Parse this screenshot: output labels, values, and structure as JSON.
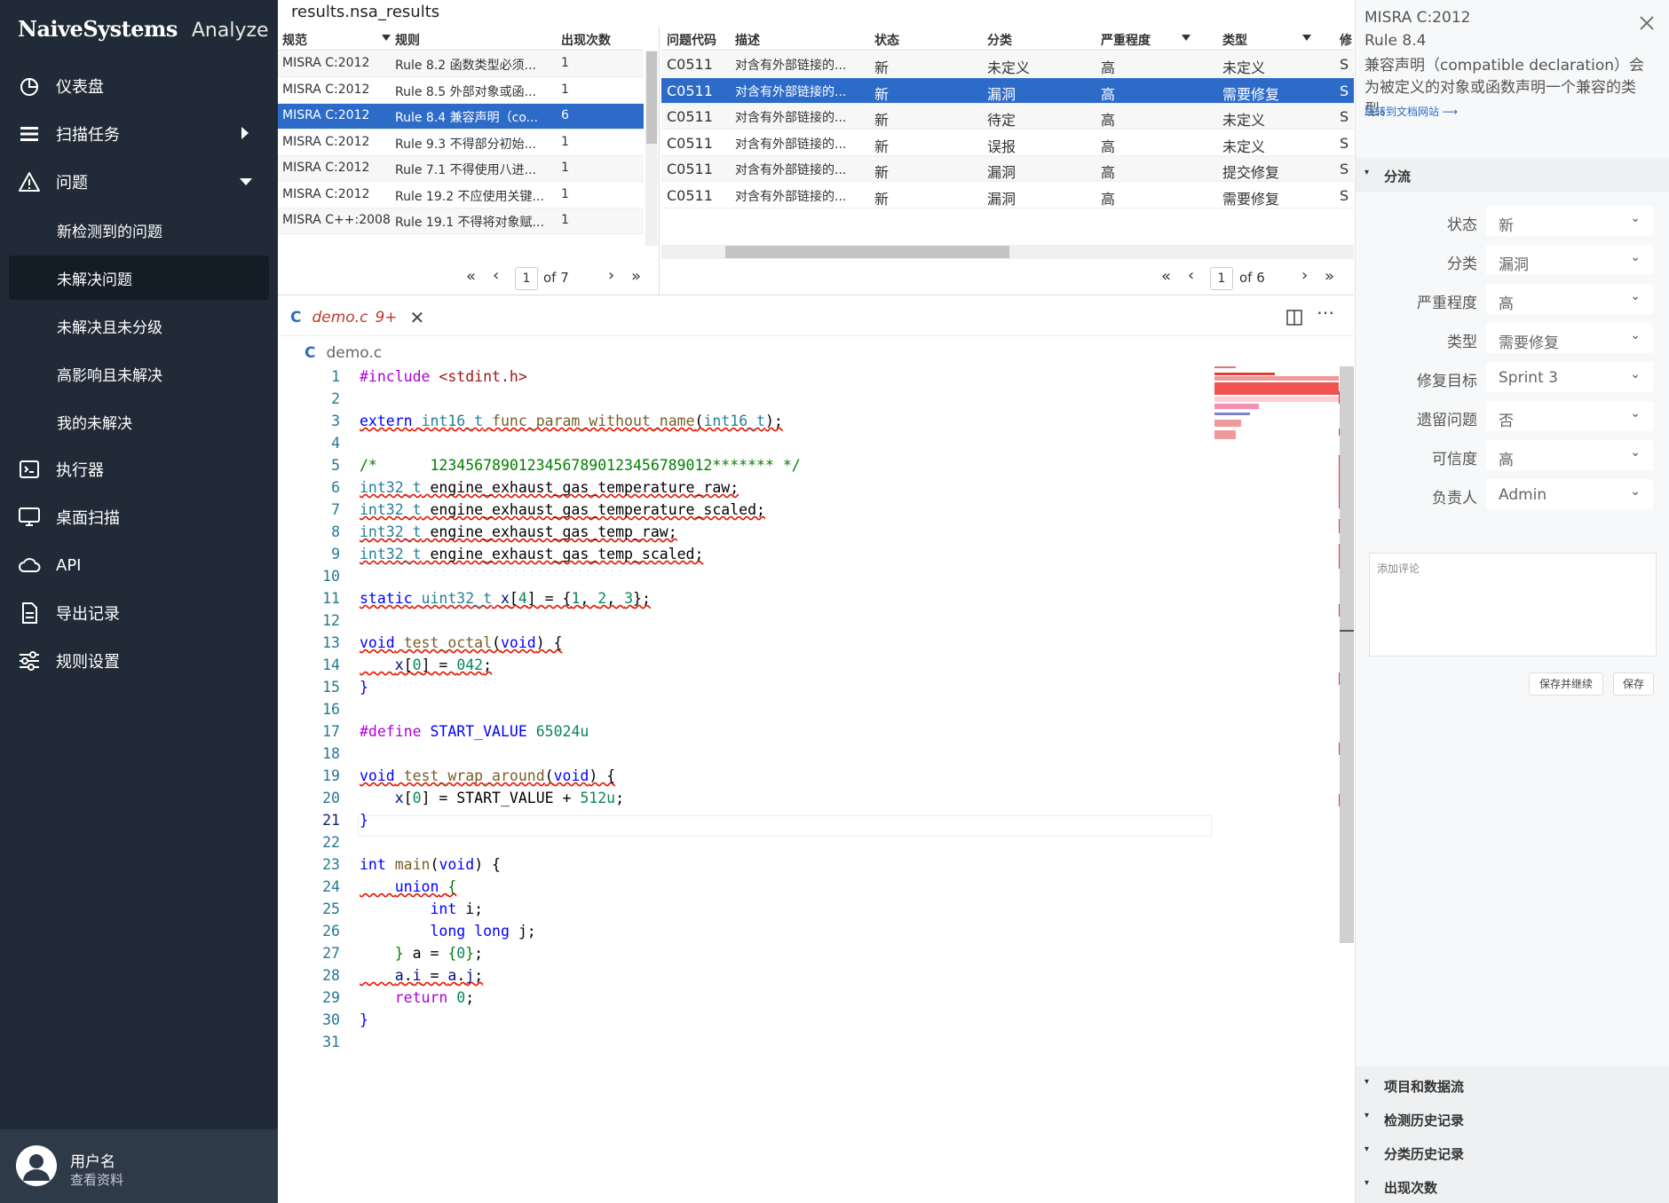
{
  "brand": {
    "name": "NaiveSystems",
    "product": "Analyze"
  },
  "nav": [
    {
      "label": "仪表盘",
      "icon": "dashboard-icon"
    },
    {
      "label": "扫描任务",
      "icon": "list-icon"
    },
    {
      "label": "问题",
      "icon": "warning-icon"
    }
  ],
  "issues_sub": [
    "新检测到的问题",
    "未解决问题",
    "未解决且未分级",
    "高影响且未解决",
    "我的未解决"
  ],
  "nav2": [
    {
      "label": "执行器",
      "icon": "terminal-icon"
    },
    {
      "label": "桌面扫描",
      "icon": "monitor-icon"
    },
    {
      "label": "API",
      "icon": "cloud-icon"
    },
    {
      "label": "导出记录",
      "icon": "document-icon"
    },
    {
      "label": "规则设置",
      "icon": "sliders-icon"
    }
  ],
  "user": {
    "name": "用户名",
    "link": "查看资料"
  },
  "results_title": "results.nsa_results",
  "rules_table": {
    "headers": [
      "规范",
      "规则",
      "出现次数"
    ],
    "rows": [
      [
        "MISRA C:2012",
        "Rule 8.2 函数类型必须...",
        "1"
      ],
      [
        "MISRA C:2012",
        "Rule 8.5 外部对象或函...",
        "1"
      ],
      [
        "MISRA C:2012",
        "Rule 8.4 兼容声明（co...",
        "6"
      ],
      [
        "MISRA C:2012",
        "Rule 9.3 不得部分初始...",
        "1"
      ],
      [
        "MISRA C:2012",
        "Rule 7.1  不得使用八进...",
        "1"
      ],
      [
        "MISRA C:2012",
        "Rule 19.2 不应使用关键...",
        "1"
      ],
      [
        "MISRA C++:2008",
        "Rule 19.1 不得将对象赋...",
        "1"
      ]
    ],
    "page": "1",
    "of": "of 7"
  },
  "issues_table": {
    "headers": [
      "问题代码",
      "描述",
      "状态",
      "分类",
      "严重程度",
      "类型",
      "修"
    ],
    "rows": [
      [
        "C0511",
        "对含有外部链接的...",
        "新",
        "未定义",
        "高",
        "未定义",
        "S"
      ],
      [
        "C0511",
        "对含有外部链接的...",
        "新",
        "漏洞",
        "高",
        "需要修复",
        "S"
      ],
      [
        "C0511",
        "对含有外部链接的...",
        "新",
        "待定",
        "高",
        "未定义",
        "S"
      ],
      [
        "C0511",
        "对含有外部链接的...",
        "新",
        "误报",
        "高",
        "未定义",
        "S"
      ],
      [
        "C0511",
        "对含有外部链接的...",
        "新",
        "漏洞",
        "高",
        "提交修复",
        "S"
      ],
      [
        "C0511",
        "对含有外部链接的...",
        "新",
        "漏洞",
        "高",
        "需要修复",
        "S"
      ]
    ],
    "page": "1",
    "of": "of 6"
  },
  "editor": {
    "tab_lang": "C",
    "tab_name": "demo.c",
    "tab_badge": "9+",
    "breadcrumb": "demo.c",
    "current_line": "21"
  },
  "panel": {
    "title1": "MISRA C:2012",
    "title2": "Rule 8.4",
    "description": "兼容声明（compatible declaration）会为被定义的对象或函数声明一个兼容的类型。",
    "doc_link": "跳转到文档网站 ⟶",
    "section_triage": "分流",
    "fields": [
      {
        "label": "状态",
        "value": "新"
      },
      {
        "label": "分类",
        "value": "漏洞"
      },
      {
        "label": "严重程度",
        "value": "高"
      },
      {
        "label": "类型",
        "value": "需要修复"
      },
      {
        "label": "修复目标",
        "value": "Sprint 3"
      },
      {
        "label": "遗留问题",
        "value": "否"
      },
      {
        "label": "可信度",
        "value": "高"
      },
      {
        "label": "负责人",
        "value": "Admin"
      }
    ],
    "comment_placeholder": "添加评论",
    "save_continue": "保存并继续",
    "save": "保存",
    "sections": [
      "项目和数据流",
      "检测历史记录",
      "分类历史记录",
      "出现次数"
    ]
  },
  "accent": "#2d6bc9"
}
